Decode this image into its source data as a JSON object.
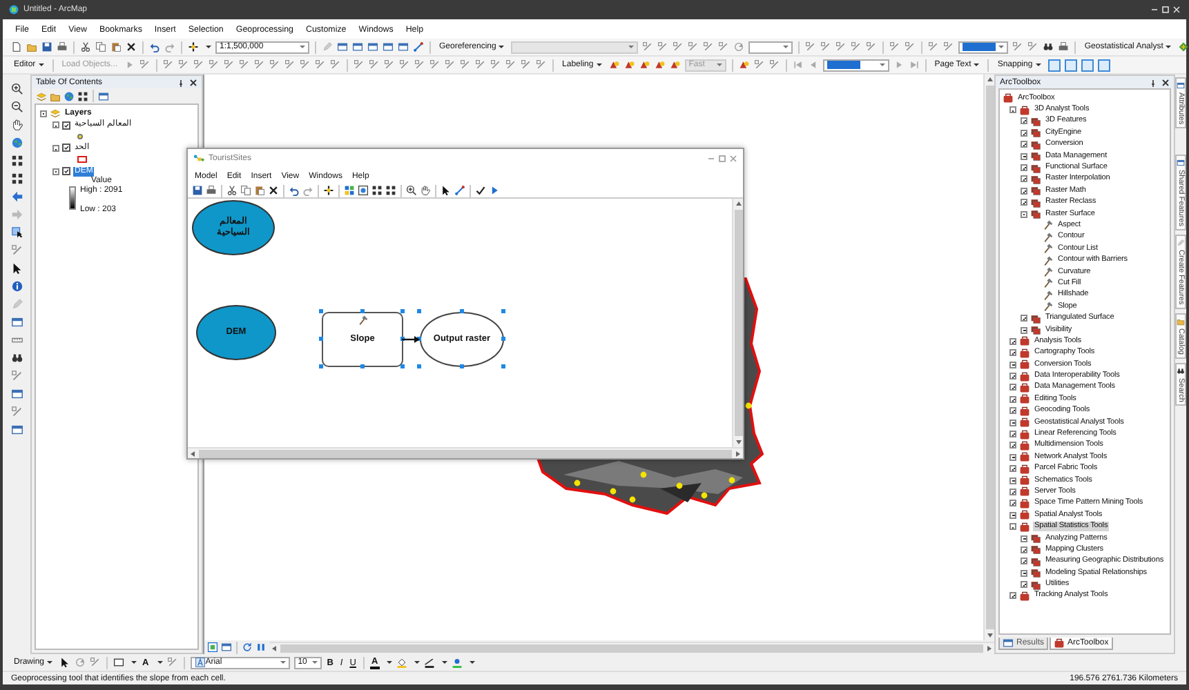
{
  "window": {
    "title": "Untitled - ArcMap"
  },
  "menu": [
    "File",
    "Edit",
    "View",
    "Bookmarks",
    "Insert",
    "Selection",
    "Geoprocessing",
    "Customize",
    "Windows",
    "Help"
  ],
  "toolbar_1": {
    "scale": "1:1,500,000",
    "georeferencing": "Georeferencing",
    "geostatistical": "Geostatistical Analyst"
  },
  "toolbar_2": {
    "editor": "Editor",
    "load_objects": "Load Objects...",
    "labeling": "Labeling",
    "label_quality": "Fast",
    "page_text": "Page Text",
    "snapping": "Snapping"
  },
  "toc": {
    "title": "Table Of Contents",
    "root": {
      "label": "Layers",
      "expanded": true,
      "selected": false
    },
    "layers": [
      {
        "label": "المعالم السياحية",
        "kind": "point",
        "checked": true,
        "expanded": true,
        "selected": false
      },
      {
        "label": "الحد",
        "kind": "polygon",
        "checked": true,
        "expanded": true,
        "selected": false
      },
      {
        "label": "DEM",
        "kind": "raster",
        "checked": true,
        "expanded": true,
        "selected": true,
        "legend": {
          "heading": "Value",
          "high": "High : 2091",
          "low": "Low : 203"
        }
      }
    ]
  },
  "model": {
    "title": "TouristSites",
    "menu": [
      "Model",
      "Edit",
      "Insert",
      "View",
      "Windows",
      "Help"
    ],
    "nodes": [
      {
        "kind": "input",
        "label": "المعالم السياحية",
        "selected": false
      },
      {
        "kind": "input",
        "label": "DEM",
        "selected": false
      },
      {
        "kind": "tool",
        "label": "Slope",
        "selected": true
      },
      {
        "kind": "output",
        "label": "Output raster",
        "selected": true
      }
    ]
  },
  "toolbox": {
    "title": "ArcToolbox",
    "tree": [
      {
        "kind": "root",
        "label": "ArcToolbox",
        "selected": false,
        "children": [
          {
            "kind": "toolbox",
            "label": "3D Analyst Tools",
            "expanded": true,
            "selected": false,
            "children": [
              {
                "kind": "toolset",
                "label": "3D Features",
                "expanded": false,
                "selected": false
              },
              {
                "kind": "toolset",
                "label": "CityEngine",
                "expanded": false,
                "selected": false
              },
              {
                "kind": "toolset",
                "label": "Conversion",
                "expanded": false,
                "selected": false
              },
              {
                "kind": "toolset",
                "label": "Data Management",
                "expanded": false,
                "selected": false
              },
              {
                "kind": "toolset",
                "label": "Functional Surface",
                "expanded": false,
                "selected": false
              },
              {
                "kind": "toolset",
                "label": "Raster Interpolation",
                "expanded": false,
                "selected": false
              },
              {
                "kind": "toolset",
                "label": "Raster Math",
                "expanded": false,
                "selected": false
              },
              {
                "kind": "toolset",
                "label": "Raster Reclass",
                "expanded": false,
                "selected": false
              },
              {
                "kind": "toolset",
                "label": "Raster Surface",
                "expanded": true,
                "selected": false,
                "children": [
                  {
                    "kind": "tool",
                    "label": "Aspect",
                    "selected": false
                  },
                  {
                    "kind": "tool",
                    "label": "Contour",
                    "selected": false
                  },
                  {
                    "kind": "tool",
                    "label": "Contour List",
                    "selected": false
                  },
                  {
                    "kind": "tool",
                    "label": "Contour with Barriers",
                    "selected": false
                  },
                  {
                    "kind": "tool",
                    "label": "Curvature",
                    "selected": false
                  },
                  {
                    "kind": "tool",
                    "label": "Cut Fill",
                    "selected": false
                  },
                  {
                    "kind": "tool",
                    "label": "Hillshade",
                    "selected": false
                  },
                  {
                    "kind": "tool",
                    "label": "Slope",
                    "selected": false
                  }
                ]
              },
              {
                "kind": "toolset",
                "label": "Triangulated Surface",
                "expanded": false,
                "selected": false
              },
              {
                "kind": "toolset",
                "label": "Visibility",
                "expanded": false,
                "selected": false
              }
            ]
          },
          {
            "kind": "toolbox",
            "label": "Analysis Tools",
            "expanded": false,
            "selected": false
          },
          {
            "kind": "toolbox",
            "label": "Cartography Tools",
            "expanded": false,
            "selected": false
          },
          {
            "kind": "toolbox",
            "label": "Conversion Tools",
            "expanded": false,
            "selected": false
          },
          {
            "kind": "toolbox",
            "label": "Data Interoperability Tools",
            "expanded": false,
            "selected": false
          },
          {
            "kind": "toolbox",
            "label": "Data Management Tools",
            "expanded": false,
            "selected": false
          },
          {
            "kind": "toolbox",
            "label": "Editing Tools",
            "expanded": false,
            "selected": false
          },
          {
            "kind": "toolbox",
            "label": "Geocoding Tools",
            "expanded": false,
            "selected": false
          },
          {
            "kind": "toolbox",
            "label": "Geostatistical Analyst Tools",
            "expanded": false,
            "selected": false
          },
          {
            "kind": "toolbox",
            "label": "Linear Referencing Tools",
            "expanded": false,
            "selected": false
          },
          {
            "kind": "toolbox",
            "label": "Multidimension Tools",
            "expanded": false,
            "selected": false
          },
          {
            "kind": "toolbox",
            "label": "Network Analyst Tools",
            "expanded": false,
            "selected": false
          },
          {
            "kind": "toolbox",
            "label": "Parcel Fabric Tools",
            "expanded": false,
            "selected": false
          },
          {
            "kind": "toolbox",
            "label": "Schematics Tools",
            "expanded": false,
            "selected": false
          },
          {
            "kind": "toolbox",
            "label": "Server Tools",
            "expanded": false,
            "selected": false
          },
          {
            "kind": "toolbox",
            "label": "Space Time Pattern Mining Tools",
            "expanded": false,
            "selected": false
          },
          {
            "kind": "toolbox",
            "label": "Spatial Analyst Tools",
            "expanded": false,
            "selected": false
          },
          {
            "kind": "toolbox",
            "label": "Spatial Statistics Tools",
            "expanded": true,
            "selected": true,
            "children": [
              {
                "kind": "toolset",
                "label": "Analyzing Patterns",
                "expanded": false,
                "selected": false
              },
              {
                "kind": "toolset",
                "label": "Mapping Clusters",
                "expanded": false,
                "selected": false
              },
              {
                "kind": "toolset",
                "label": "Measuring Geographic Distributions",
                "expanded": false,
                "selected": false
              },
              {
                "kind": "toolset",
                "label": "Modeling Spatial Relationships",
                "expanded": false,
                "selected": false
              },
              {
                "kind": "toolset",
                "label": "Utilities",
                "expanded": false,
                "selected": false
              }
            ]
          },
          {
            "kind": "toolbox",
            "label": "Tracking Analyst Tools",
            "expanded": false,
            "selected": false
          }
        ]
      }
    ]
  },
  "dock_tabs": [
    {
      "label": "Results",
      "selected": false
    },
    {
      "label": "ArcToolbox",
      "selected": true
    }
  ],
  "side_tabs": [
    "Attributes",
    "Shared Features",
    "Create Features",
    "Catalog",
    "Search"
  ],
  "drawing_toolbar": {
    "label": "Drawing",
    "text_tool": "A",
    "font": "Arial",
    "size": "10",
    "bold": "B",
    "italic": "I",
    "underline": "U",
    "font_color": "A"
  },
  "status_bar": {
    "message": "Geoprocessing tool that identifies the slope from each cell.",
    "coordinates": "196.576 2761.736 Kilometers"
  }
}
